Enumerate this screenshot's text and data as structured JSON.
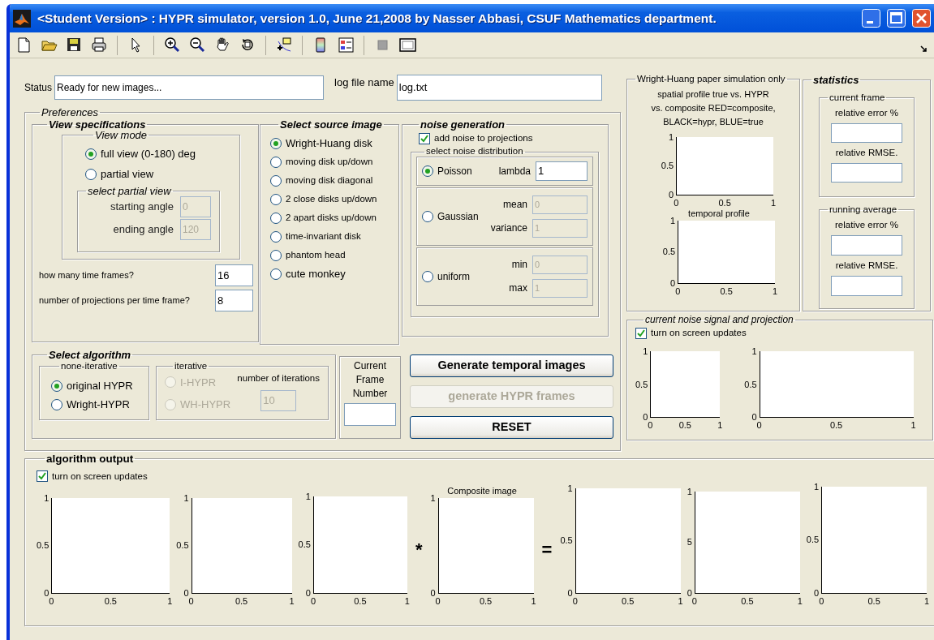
{
  "window": {
    "title": "<Student Version> : HYPR simulator, version 1.0, June 21,2008 by Nasser Abbasi, CSUF Mathematics department."
  },
  "status": {
    "label": "Status",
    "value": "Ready for new images..."
  },
  "log_file": {
    "label": "log file name",
    "value": "log.txt"
  },
  "preferences": {
    "title": "Preferences",
    "view_specifications": {
      "title": "View specifications",
      "view_mode": {
        "title": "View mode",
        "options": [
          {
            "label": "full view (0-180) deg",
            "selected": true
          },
          {
            "label": "partial view",
            "selected": false
          }
        ],
        "partial_view": {
          "title": "select partial view",
          "fields": [
            {
              "label": "starting angle",
              "value": "0",
              "disabled": true
            },
            {
              "label": "ending angle",
              "value": "120",
              "disabled": true
            }
          ]
        }
      },
      "fields": [
        {
          "label": "how many time frames?",
          "value": "16"
        },
        {
          "label": "number of projections per time frame?",
          "value": "8"
        }
      ]
    },
    "source_image": {
      "title": "Select source image",
      "options": [
        {
          "label": "Wright-Huang disk",
          "selected": true
        },
        {
          "label": "moving disk up/down",
          "selected": false
        },
        {
          "label": "moving disk diagonal",
          "selected": false
        },
        {
          "label": "2 close disks up/down",
          "selected": false
        },
        {
          "label": "2 apart disks up/down",
          "selected": false
        },
        {
          "label": "time-invariant disk",
          "selected": false
        },
        {
          "label": "phantom head",
          "selected": false
        },
        {
          "label": "cute monkey",
          "selected": false
        }
      ]
    },
    "noise_generation": {
      "title": "noise generation",
      "add_noise": {
        "label": "add noise to projections",
        "checked": true
      },
      "distribution": {
        "title": "select noise distribution",
        "options": [
          {
            "label": "Poisson",
            "selected": true,
            "fields": [
              {
                "label": "lambda",
                "value": "1",
                "disabled": false
              }
            ]
          },
          {
            "label": "Gaussian",
            "selected": false,
            "fields": [
              {
                "label": "mean",
                "value": "0",
                "disabled": true
              },
              {
                "label": "variance",
                "value": "1",
                "disabled": true
              }
            ]
          },
          {
            "label": "uniform",
            "selected": false,
            "fields": [
              {
                "label": "min",
                "value": "0",
                "disabled": true
              },
              {
                "label": "max",
                "value": "1",
                "disabled": true
              }
            ]
          }
        ]
      }
    },
    "algorithm": {
      "title": "Select algorithm",
      "non_iterative": {
        "title": "none-iterative",
        "options": [
          {
            "label": "original HYPR",
            "selected": true,
            "disabled": false
          },
          {
            "label": "Wright-HYPR",
            "selected": false,
            "disabled": false
          }
        ]
      },
      "iterative": {
        "title": "iterative",
        "options": [
          {
            "label": "I-HYPR",
            "selected": false,
            "disabled": true
          },
          {
            "label": "WH-HYPR",
            "selected": false,
            "disabled": true
          }
        ],
        "iterations": {
          "label": "number of iterations",
          "value": "10",
          "disabled": true
        }
      }
    },
    "current_frame": {
      "label": "Current Frame Number"
    },
    "buttons": [
      {
        "label": "Generate temporal images",
        "disabled": false
      },
      {
        "label": "generate HYPR frames",
        "disabled": true
      },
      {
        "label": "RESET",
        "disabled": false
      }
    ]
  },
  "wright_huang": {
    "title": "Wright-Huang paper simulation only",
    "caption_lines": [
      "spatial profile true vs. HYPR",
      "vs. composite RED=composite,",
      "BLACK=hypr, BLUE=true"
    ],
    "axes": [
      {
        "xticks": [
          "0",
          "0.5",
          "1"
        ],
        "yticks": [
          "1",
          "0.5",
          "0"
        ]
      },
      {
        "title": "temporal profile",
        "xticks": [
          "0",
          "0.5",
          "1"
        ],
        "yticks": [
          "1",
          "0.5",
          "0"
        ]
      }
    ]
  },
  "statistics": {
    "title": "statistics",
    "groups": [
      {
        "title": "current frame",
        "fields": [
          {
            "label": "relative error %"
          },
          {
            "label": "relative RMSE."
          }
        ]
      },
      {
        "title": "running average",
        "fields": [
          {
            "label": "relative error %"
          },
          {
            "label": "relative RMSE."
          }
        ]
      }
    ]
  },
  "noise_signal": {
    "title": "current noise signal and projection",
    "screen_updates": {
      "label": "turn on screen updates",
      "checked": true
    },
    "axes": [
      {
        "xticks": [
          "0",
          "0.5",
          "1"
        ],
        "yticks": [
          "1",
          "0.5",
          "0"
        ]
      },
      {
        "xticks": [
          "0",
          "0.5",
          "1"
        ],
        "yticks": [
          "1",
          "0.5",
          "0"
        ]
      }
    ]
  },
  "algorithm_output": {
    "title": "algorithm output",
    "screen_updates": {
      "label": "turn on screen updates",
      "checked": true
    },
    "items": [
      {
        "kind": "axes",
        "xticks": [
          "0",
          "0.5",
          "1"
        ],
        "yticks": [
          "1",
          "0.5",
          "0"
        ]
      },
      {
        "kind": "axes",
        "xticks": [
          "0",
          "0.5",
          "1"
        ],
        "yticks": [
          "1",
          "0.5",
          "0"
        ]
      },
      {
        "kind": "axes",
        "xticks": [
          "0",
          "0.5",
          "1"
        ],
        "yticks": [
          "1",
          "0.5",
          "0"
        ]
      },
      {
        "kind": "operator",
        "symbol": "*"
      },
      {
        "kind": "axes",
        "title": "Composite image",
        "xticks": [
          "0",
          "0.5",
          "1"
        ],
        "yticks": [
          "1",
          "0"
        ]
      },
      {
        "kind": "operator",
        "symbol": "="
      },
      {
        "kind": "axes",
        "xticks": [
          "0",
          "0.5",
          "1"
        ],
        "yticks": [
          "1",
          "0.5",
          "0"
        ]
      },
      {
        "kind": "axes",
        "xticks": [
          "0",
          "0.5",
          "1"
        ],
        "yticks": [
          "1",
          "5",
          "0"
        ]
      },
      {
        "kind": "axes",
        "xticks": [
          "0",
          "0.5",
          "1"
        ],
        "yticks": [
          "1",
          "0.5",
          "0"
        ]
      }
    ]
  }
}
